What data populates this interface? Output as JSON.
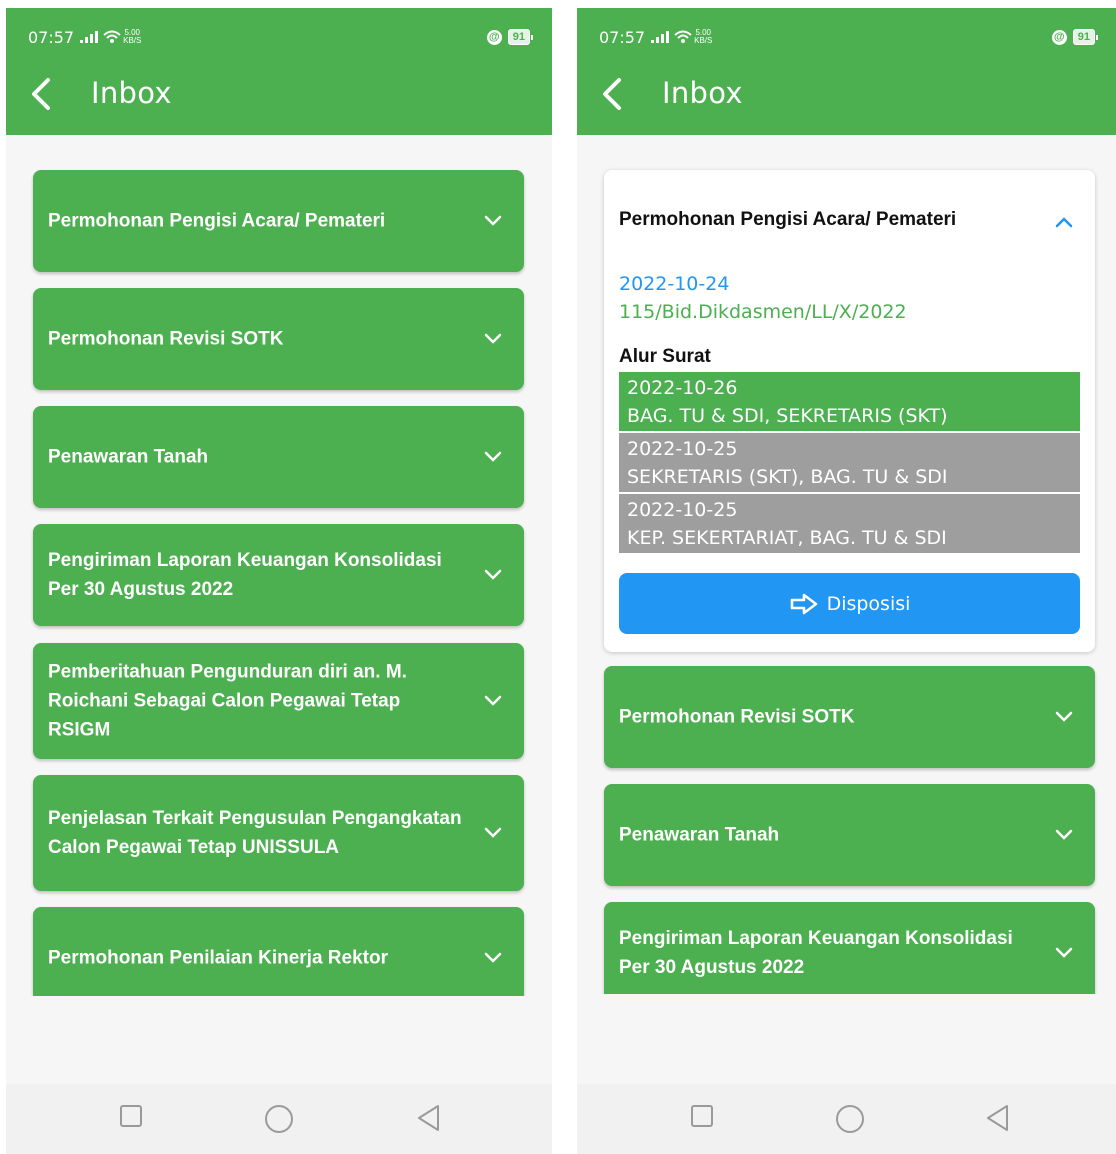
{
  "status": {
    "time": "07:57",
    "net_speed_value": "5.00",
    "net_speed_unit": "KB/S",
    "battery": "91"
  },
  "header": {
    "title": "Inbox"
  },
  "left_list": [
    {
      "title": "Permohonan Pengisi Acara/ Pemateri"
    },
    {
      "title": "Permohonan Revisi SOTK"
    },
    {
      "title": "Penawaran Tanah"
    },
    {
      "title": "Pengiriman Laporan Keuangan Konsolidasi Per 30 Agustus 2022"
    },
    {
      "title": "Pemberitahuan Pengunduran diri an. M. Roichani Sebagai Calon Pegawai Tetap RSIGM"
    },
    {
      "title": "Penjelasan Terkait Pengusulan Pengangkatan Calon Pegawai Tetap UNISSULA"
    },
    {
      "title": "Permohonan Penilaian Kinerja Rektor"
    }
  ],
  "expanded": {
    "title": "Permohonan Pengisi Acara/ Pemateri",
    "date": "2022-10-24",
    "number": "115/Bid.Dikdasmen/LL/X/2022",
    "alur_label": "Alur Surat",
    "flow": [
      {
        "date": "2022-10-26",
        "route": "BAG. TU & SDI, SEKRETARIS (SKT)",
        "state": "active"
      },
      {
        "date": "2022-10-25",
        "route": "SEKRETARIS (SKT), BAG. TU & SDI",
        "state": "done"
      },
      {
        "date": "2022-10-25",
        "route": "KEP. SEKERTARIAT, BAG. TU & SDI",
        "state": "done"
      }
    ],
    "action_label": "Disposisi"
  },
  "right_list": [
    {
      "title": "Permohonan Revisi SOTK"
    },
    {
      "title": "Penawaran Tanah"
    },
    {
      "title": "Pengiriman Laporan Keuangan Konsolidasi Per 30 Agustus 2022"
    }
  ],
  "colors": {
    "primary": "#4caf50",
    "accent": "#2196f3",
    "muted": "#9e9e9e",
    "background": "#f6f6f6"
  },
  "icons": [
    "back-arrow-icon",
    "chevron-down-icon",
    "chevron-up-icon",
    "arrow-right-icon",
    "signal-icon",
    "wifi-icon",
    "lock-icon",
    "battery-icon",
    "recent-apps-icon",
    "home-icon",
    "back-nav-icon"
  ]
}
